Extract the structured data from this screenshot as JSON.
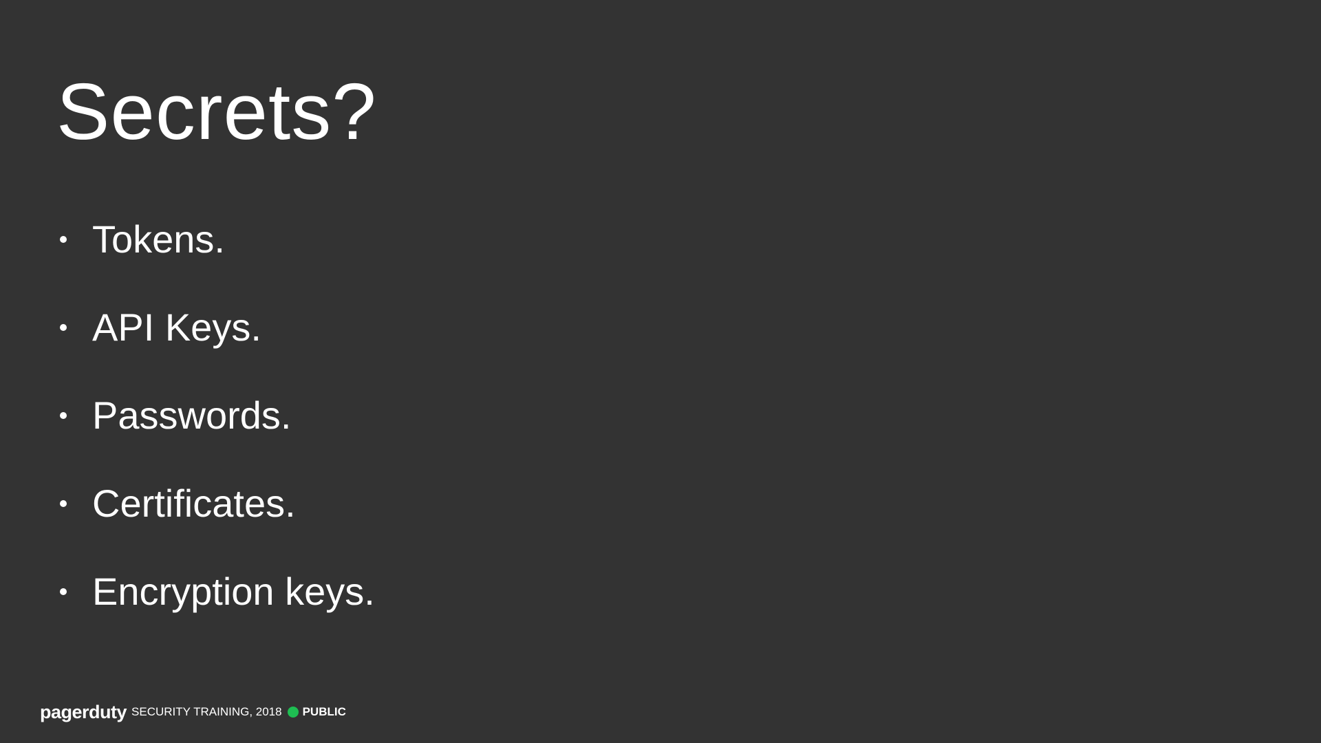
{
  "slide": {
    "title": "Secrets?",
    "bullets": [
      "Tokens.",
      "API Keys.",
      "Passwords.",
      "Certificates.",
      "Encryption keys."
    ]
  },
  "footer": {
    "logo": "pagerduty",
    "training_label": "SECURITY TRAINING, 2018",
    "classification": "PUBLIC",
    "status_color": "#1ebe52"
  },
  "colors": {
    "background": "#333333",
    "text": "#ffffff",
    "accent_green": "#1ebe52"
  }
}
